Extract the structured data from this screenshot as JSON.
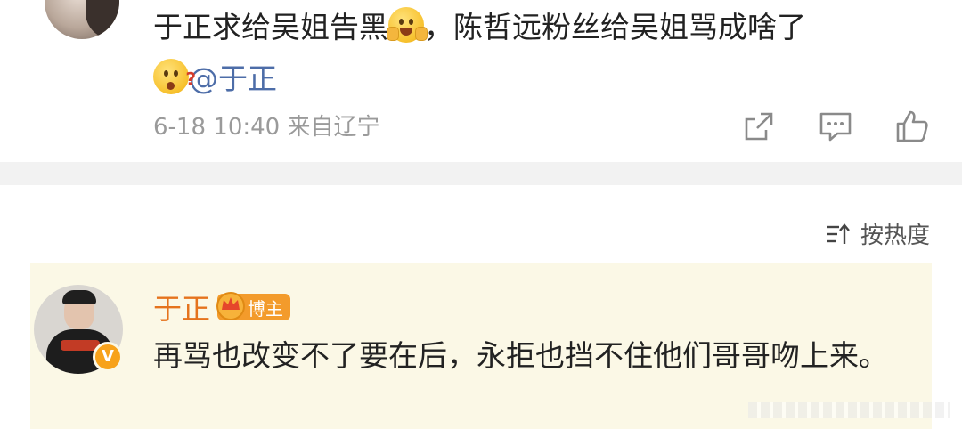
{
  "post": {
    "text_part1": "于正求给吴姐告黑",
    "text_part2": "，陈哲远粉丝给吴姐骂成啥了",
    "mention": "@于正",
    "emoji1": "grinning-hands-emoji",
    "emoji2": "confused-question-emoji",
    "timestamp": "6-18 10:40",
    "location": "来自辽宁",
    "actions": [
      "share-icon",
      "comment-icon",
      "like-icon"
    ]
  },
  "sort": {
    "icon": "sort-icon",
    "label": "按热度"
  },
  "comment": {
    "author": "于正",
    "badge": "博主",
    "verified_mark": "V",
    "text": "再骂也改变不了要在后，永拒也挡不住他们哥哥吻上来。"
  },
  "colors": {
    "comment_bg": "#fbf8e6",
    "author_name": "#e5731d",
    "badge_bg": "#f39b2b",
    "mention": "#4d6da8",
    "meta": "#9a9a9a"
  }
}
